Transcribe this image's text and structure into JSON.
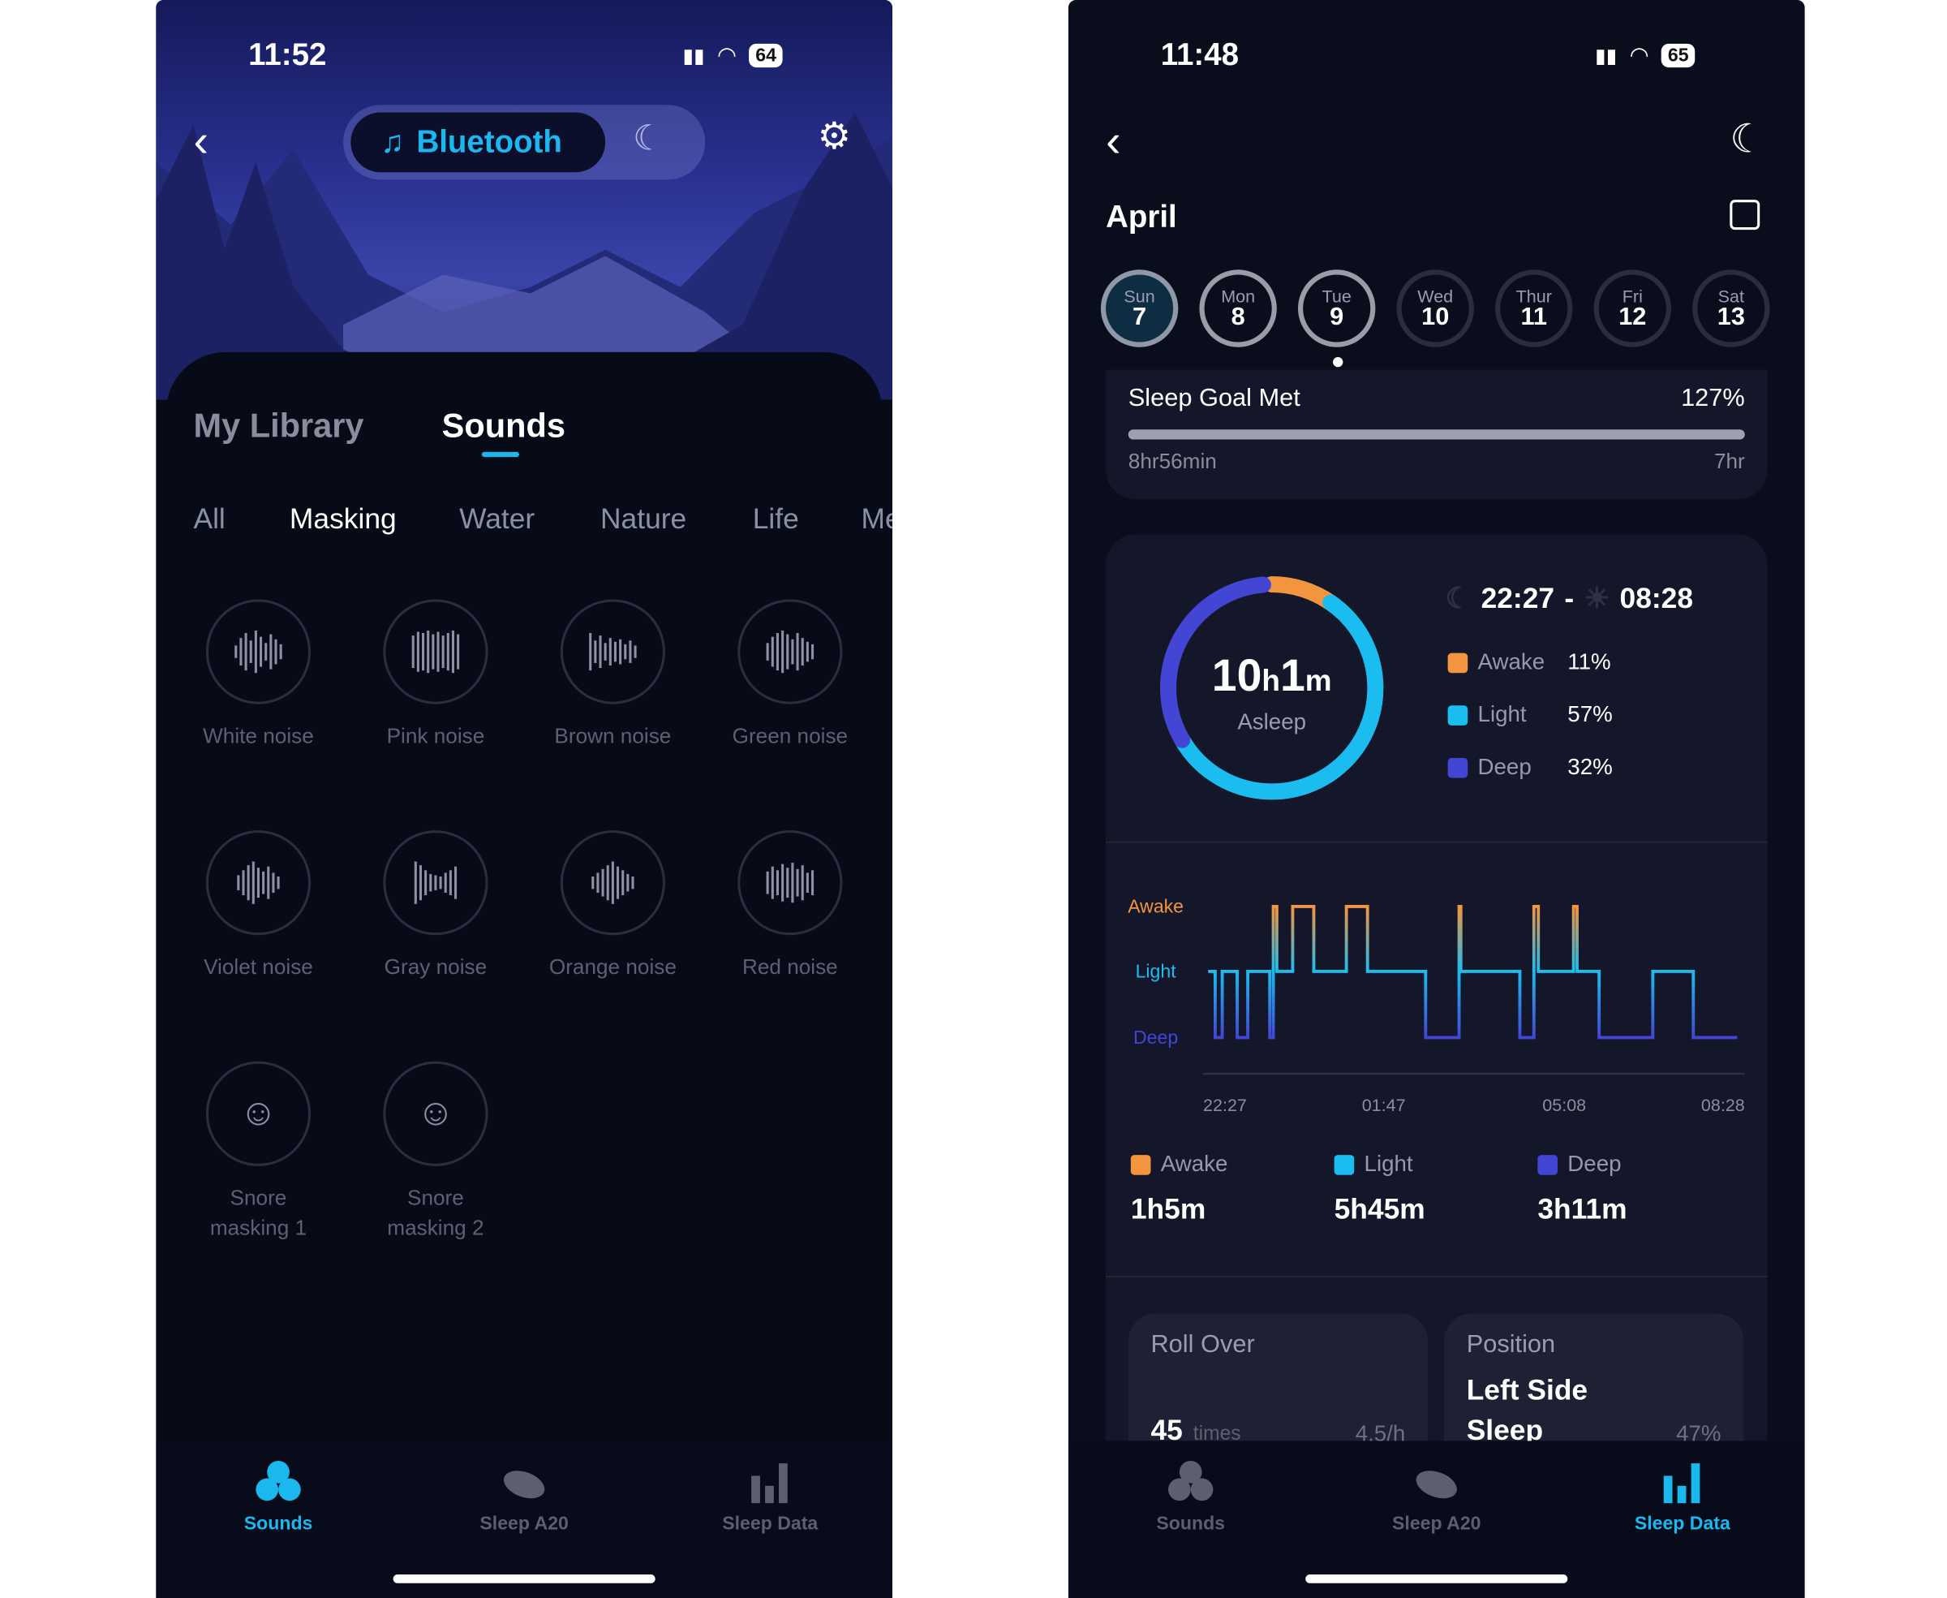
{
  "colors": {
    "accent": "#1ab8ee",
    "awake": "#f3953f",
    "light": "#1bbcf0",
    "deep": "#4346d4"
  },
  "left": {
    "status": {
      "time": "11:52",
      "battery": "64"
    },
    "header": {
      "mode_active": "Bluetooth",
      "mode_icon": "music-note-icon",
      "mode_other_icon": "moon-sleep-icon"
    },
    "tabs": [
      {
        "label": "My Library",
        "active": false
      },
      {
        "label": "Sounds",
        "active": true
      }
    ],
    "categories": [
      {
        "label": "All"
      },
      {
        "label": "Masking",
        "active": true
      },
      {
        "label": "Water"
      },
      {
        "label": "Nature"
      },
      {
        "label": "Life"
      },
      {
        "label": "Me"
      }
    ],
    "sounds": [
      {
        "label": "White noise"
      },
      {
        "label": "Pink noise"
      },
      {
        "label": "Brown noise"
      },
      {
        "label": "Green noise"
      },
      {
        "label": "Violet noise"
      },
      {
        "label": "Gray noise"
      },
      {
        "label": "Orange noise"
      },
      {
        "label": "Red noise"
      },
      {
        "label": "Snore masking 1"
      },
      {
        "label": "Snore masking 2"
      }
    ],
    "tabbar": [
      {
        "label": "Sounds",
        "active": true
      },
      {
        "label": "Sleep A20"
      },
      {
        "label": "Sleep Data"
      }
    ]
  },
  "right": {
    "status": {
      "time": "11:48",
      "battery": "65"
    },
    "month": "April",
    "days": [
      {
        "dow": "Sun",
        "num": "7",
        "selected": true
      },
      {
        "dow": "Mon",
        "num": "8"
      },
      {
        "dow": "Tue",
        "num": "9",
        "today": true
      },
      {
        "dow": "Wed",
        "num": "10"
      },
      {
        "dow": "Thur",
        "num": "11"
      },
      {
        "dow": "Fri",
        "num": "12"
      },
      {
        "dow": "Sat",
        "num": "13"
      }
    ],
    "goal": {
      "title": "Sleep Goal Met",
      "percent": "127%",
      "actual": "8hr56min",
      "target": "7hr",
      "progress": 1.0
    },
    "summary": {
      "hours": "10",
      "h": "h",
      "minutes": "1",
      "m": "m",
      "label": "Asleep",
      "start": "22:27",
      "dash": "-",
      "end": "08:28",
      "stages": [
        {
          "name": "Awake",
          "pct": "11%",
          "value": 11
        },
        {
          "name": "Light",
          "pct": "57%",
          "value": 57
        },
        {
          "name": "Deep",
          "pct": "32%",
          "value": 32
        }
      ]
    },
    "totals": [
      {
        "name": "Awake",
        "value": "1h5m"
      },
      {
        "name": "Light",
        "value": "5h45m"
      },
      {
        "name": "Deep",
        "value": "3h11m"
      }
    ],
    "rollover": {
      "title": "Roll Over",
      "count": "45",
      "unit": "times",
      "rate": "4.5/h"
    },
    "position": {
      "title": "Position",
      "value_line1": "Left Side",
      "value_line2": "Sleep",
      "pct": "47%"
    },
    "tabbar": [
      {
        "label": "Sounds"
      },
      {
        "label": "Sleep A20"
      },
      {
        "label": "Sleep Data",
        "active": true
      }
    ]
  },
  "chart_data": {
    "type": "line",
    "step": true,
    "y_categories": [
      "Deep",
      "Light",
      "Awake"
    ],
    "x_ticks": [
      "22:27",
      "01:47",
      "05:08",
      "08:28"
    ],
    "x_range": [
      "22:27",
      "08:28"
    ],
    "segments": [
      [
        "22:27",
        "Light"
      ],
      [
        "22:35",
        "Deep"
      ],
      [
        "22:43",
        "Light"
      ],
      [
        "23:00",
        "Deep"
      ],
      [
        "23:12",
        "Light"
      ],
      [
        "23:37",
        "Deep"
      ],
      [
        "23:41",
        "Awake"
      ],
      [
        "23:45",
        "Light"
      ],
      [
        "00:03",
        "Awake"
      ],
      [
        "00:27",
        "Light"
      ],
      [
        "01:04",
        "Awake"
      ],
      [
        "01:28",
        "Light"
      ],
      [
        "02:34",
        "Deep"
      ],
      [
        "03:12",
        "Awake"
      ],
      [
        "03:14",
        "Light"
      ],
      [
        "04:21",
        "Deep"
      ],
      [
        "04:37",
        "Awake"
      ],
      [
        "04:42",
        "Light"
      ],
      [
        "05:22",
        "Awake"
      ],
      [
        "05:26",
        "Light"
      ],
      [
        "05:51",
        "Deep"
      ],
      [
        "06:52",
        "Light"
      ],
      [
        "07:38",
        "Deep"
      ],
      [
        "08:28",
        "Deep"
      ]
    ]
  }
}
